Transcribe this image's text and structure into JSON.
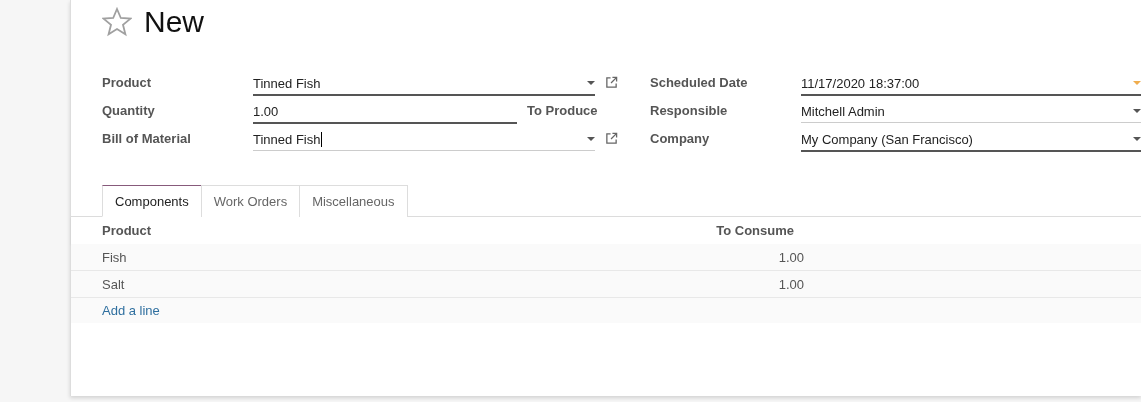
{
  "record": {
    "title": "New",
    "favorite": false
  },
  "left_fields": [
    {
      "label": "Product",
      "kind": "many2one",
      "value": "Tinned Fish",
      "required": true,
      "focused": false
    },
    {
      "label": "Quantity",
      "kind": "quantity",
      "value": "1.00",
      "suffix": "To Produce",
      "required": true,
      "focused": false
    },
    {
      "label": "Bill of Material",
      "kind": "many2one",
      "value": "Tinned Fish",
      "required": false,
      "focused": true
    }
  ],
  "right_fields": [
    {
      "label": "Scheduled Date",
      "kind": "date",
      "value": "11/17/2020 18:37:00",
      "required": true,
      "focused": false
    },
    {
      "label": "Responsible",
      "kind": "select",
      "value": "Mitchell Admin",
      "required": false,
      "focused": false
    },
    {
      "label": "Company",
      "kind": "select",
      "value": "My Company (San Francisco)",
      "required": true,
      "focused": false
    }
  ],
  "tabs": [
    {
      "label": "Components",
      "selected": true
    },
    {
      "label": "Work Orders",
      "selected": false
    },
    {
      "label": "Miscellaneous",
      "selected": false
    }
  ],
  "table": {
    "columns": [
      "Product",
      "To Consume"
    ],
    "rows": [
      [
        "Fish",
        "1.00"
      ],
      [
        "Salt",
        "1.00"
      ]
    ],
    "add_line": "Add a line"
  }
}
